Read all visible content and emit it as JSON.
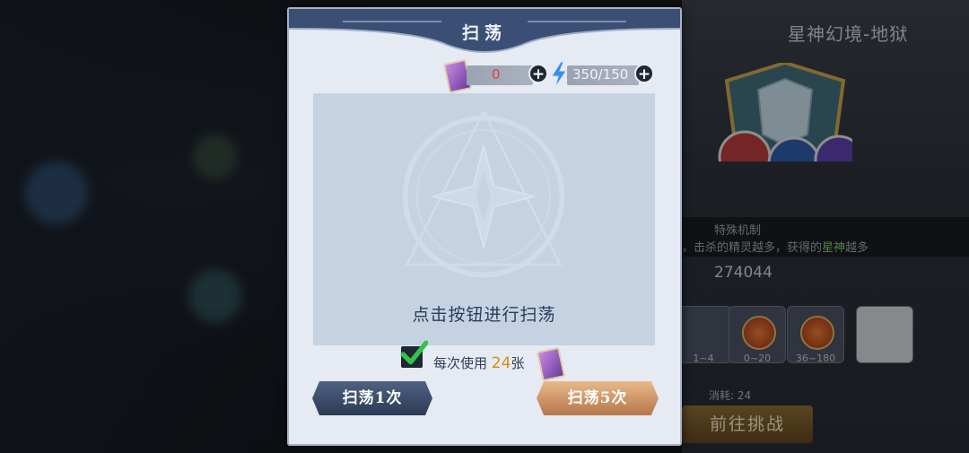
{
  "dialog": {
    "title": "扫荡",
    "tickets": {
      "value": "0"
    },
    "energy": {
      "value": "350/150"
    },
    "prompt": "点击按钮进行扫荡",
    "use_prefix": "每次使用",
    "use_count": "24",
    "use_suffix": "张",
    "auto_use_checked": true,
    "sweep_once_label": "扫荡1次",
    "sweep_five_label": "扫荡5次"
  },
  "background_panel": {
    "title": "星神幻境-地狱",
    "mechanic_title": "特殊机制",
    "mechanic_text_a": "，击杀的精灵越多，获得的",
    "mechanic_text_hl": "星神",
    "mechanic_text_b": "越多",
    "score": "274044",
    "rewards": [
      {
        "label": "1~4"
      },
      {
        "label": "0~20"
      },
      {
        "label": "36~180"
      }
    ],
    "cost_label": "消耗: 24",
    "goto_label": "前往挑战"
  },
  "colors": {
    "dialog_bg": "#e6ebf3",
    "title_band": "#3b4f74",
    "highlight_number": "#d98a10",
    "ticket_zero": "#e0403a",
    "blue_button": "#3a4b68",
    "gold_button": "#d49a6a"
  },
  "icons": [
    "ticket-card-icon",
    "plus-icon",
    "energy-bolt-icon",
    "checkmark-icon",
    "star-emblem-icon"
  ]
}
